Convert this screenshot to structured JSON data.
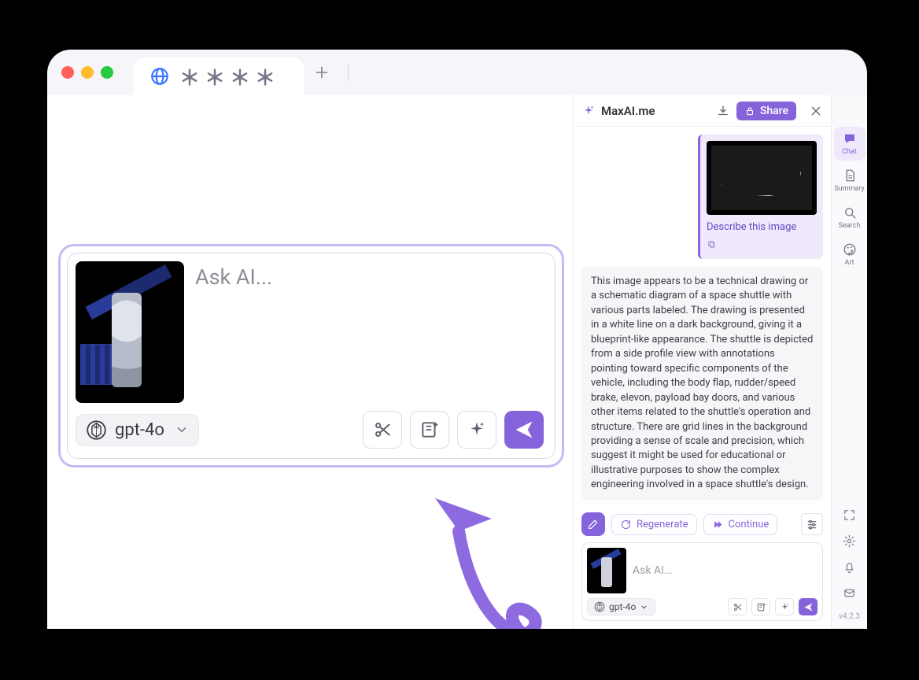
{
  "browser": {
    "tab_title": "＊＊＊＊"
  },
  "prompt": {
    "placeholder": "Ask AI...",
    "model": "gpt-4o"
  },
  "chat": {
    "brand": "MaxAI.me",
    "share_label": "Share",
    "user_prompt": "Describe this image",
    "ai_response": "This image appears to be a technical drawing or a schematic diagram of a space shuttle with various parts labeled. The drawing is presented in a white line on a dark background, giving it a blueprint-like appearance. The shuttle is depicted from a side profile view with annotations pointing toward specific components of the vehicle, including the body flap, rudder/speed brake, elevon, payload bay doors, and various other items related to the shuttle's operation and structure. There are grid lines in the background providing a sense of scale and precision, which suggest it might be used for educational or illustrative purposes to show the complex engineering involved in a space shuttle's design.",
    "regen_label": "Regenerate",
    "continue_label": "Continue",
    "mini_placeholder": "Ask AI...",
    "mini_model": "gpt-4o"
  },
  "rail": {
    "chat": "Chat",
    "summary": "Summary",
    "search": "Search",
    "art": "Art",
    "version": "v4.2.3"
  }
}
